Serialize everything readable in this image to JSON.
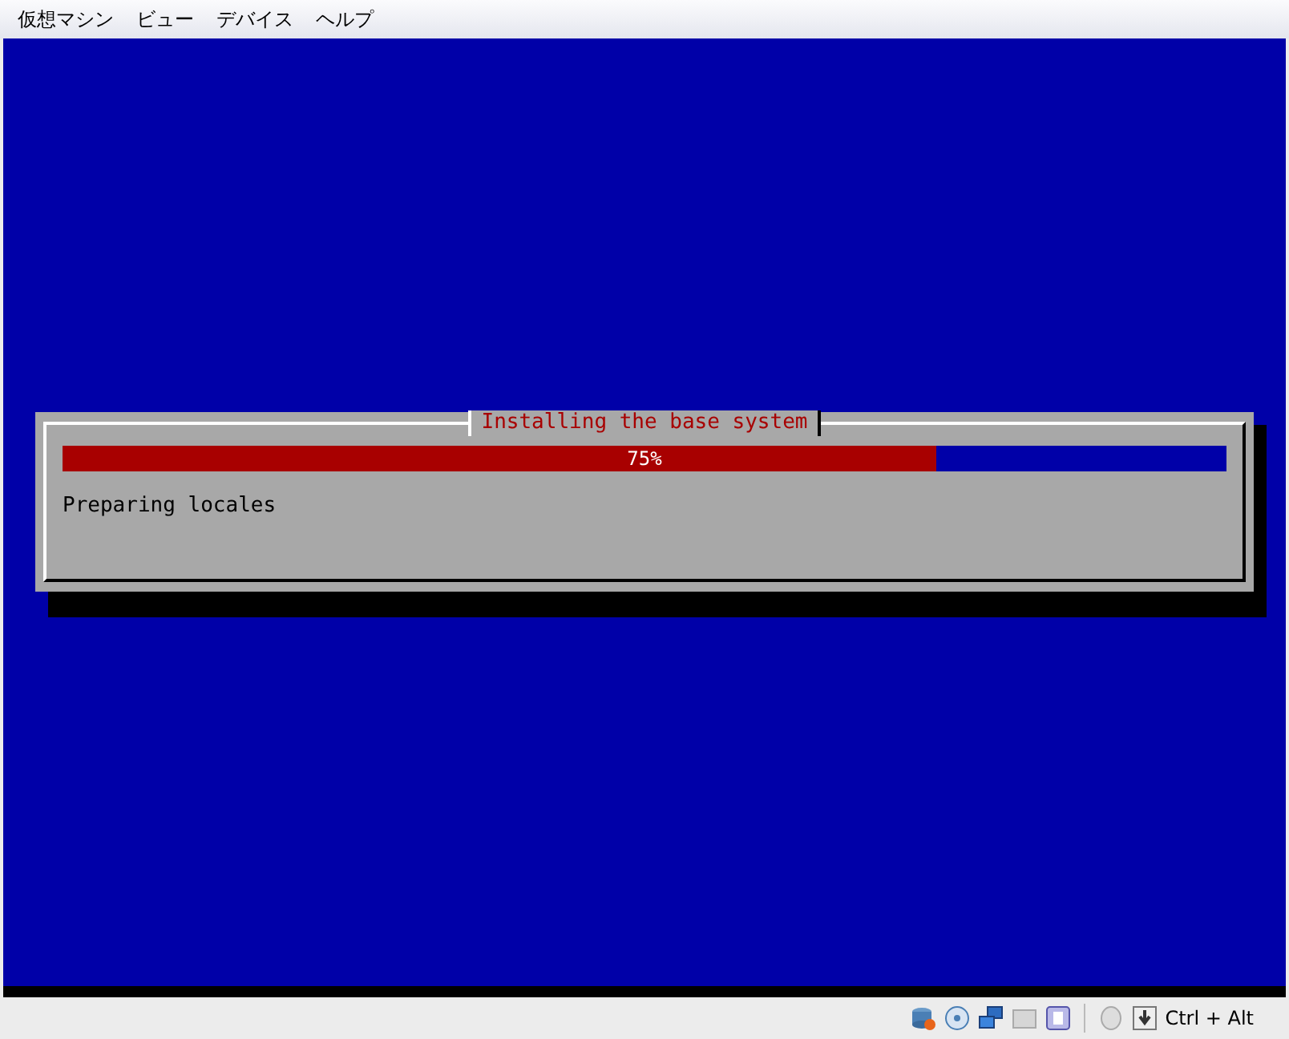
{
  "menu_bar": {
    "items": [
      "仮想マシン",
      "ビュー",
      "デバイス",
      "ヘルプ"
    ]
  },
  "dialog": {
    "title": "Installing the base system",
    "progress": {
      "level": 0.75,
      "label": "75%"
    },
    "message": "Preparing locales"
  },
  "status_bar": {
    "keyboard_hint": "Ctrl + Alt"
  }
}
